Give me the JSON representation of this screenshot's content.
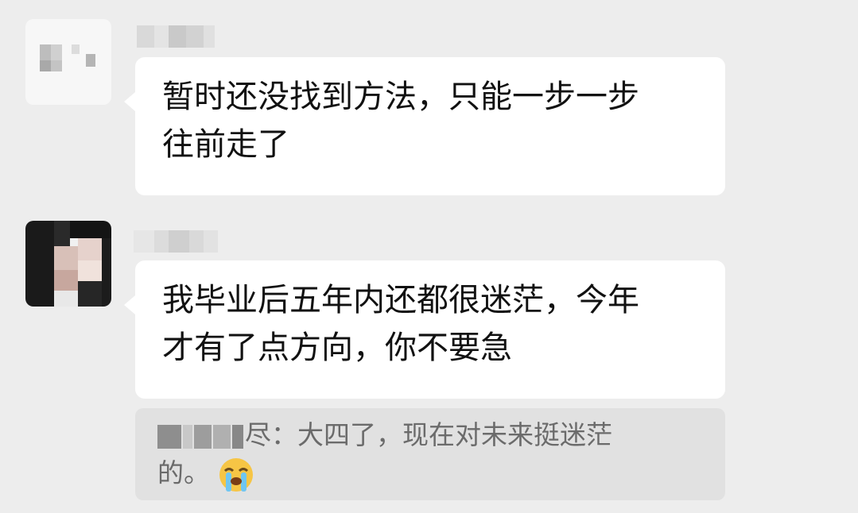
{
  "messages": [
    {
      "avatar": "blurred-avatar",
      "text_line1": "暂时还没找到方法，只能一步一步",
      "text_line2": "往前走了"
    },
    {
      "avatar": "blurred-photo-avatar",
      "text_line1": "我毕业后五年内还都很迷茫，今年",
      "text_line2": "才有了点方向，你不要急"
    }
  ],
  "quote": {
    "sender_suffix": "尽：",
    "text_line1": "大四了，现在对未来挺迷茫",
    "text_line2": "的。",
    "emoji": "crying-face-emoji"
  },
  "colors": {
    "background": "#ededed",
    "bubble": "#ffffff",
    "quote_background": "#e1e1e1",
    "quote_text": "#6b6b6b"
  }
}
